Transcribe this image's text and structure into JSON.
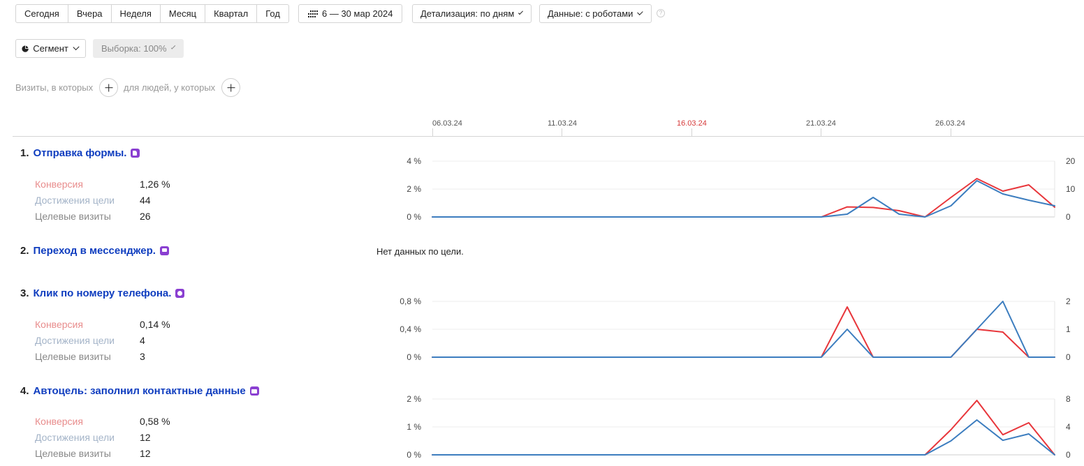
{
  "toolbar": {
    "periods": [
      "Сегодня",
      "Вчера",
      "Неделя",
      "Месяц",
      "Квартал",
      "Год"
    ],
    "date_range": "6 — 30 мар 2024",
    "detail": "Детализация: по дням",
    "data_filter": "Данные: с роботами",
    "help": "?"
  },
  "segment": {
    "segment_label": "Сегмент",
    "sample_label": "Выборка: 100%"
  },
  "filter": {
    "visits_text": "Визиты, в которых",
    "people_text": "для людей, у которых"
  },
  "timeline": {
    "dates": [
      "06.03.24",
      "11.03.24",
      "16.03.24",
      "21.03.24",
      "26.03.24"
    ],
    "holiday_date": "16.03.24"
  },
  "colors": {
    "conversion": "#e8363b",
    "reaches": "#3c7dbf",
    "goal_link": "#0f3dbf",
    "goal_icon": "#8a3fd1"
  },
  "goals": [
    {
      "num": "1.",
      "name": "Отправка формы.",
      "icon": "form-icon",
      "metrics": [
        {
          "label": "Конверсия",
          "value": "1,26 %"
        },
        {
          "label": "Достижения цели",
          "value": "44"
        },
        {
          "label": "Целевые визиты",
          "value": "26"
        }
      ]
    },
    {
      "num": "2.",
      "name": "Переход в мессенджер.",
      "icon": "chat-icon",
      "nodata": "Нет данных по цели."
    },
    {
      "num": "3.",
      "name": "Клик по номеру телефона.",
      "icon": "phone-icon",
      "metrics": [
        {
          "label": "Конверсия",
          "value": "0,14 %"
        },
        {
          "label": "Достижения цели",
          "value": "4"
        },
        {
          "label": "Целевые визиты",
          "value": "3"
        }
      ]
    },
    {
      "num": "4.",
      "name": "Автоцель: заполнил контактные данные",
      "icon": "card-icon",
      "metrics": [
        {
          "label": "Конверсия",
          "value": "0,58 %"
        },
        {
          "label": "Достижения цели",
          "value": "12"
        },
        {
          "label": "Целевые визиты",
          "value": "12"
        }
      ]
    }
  ],
  "chart_data": [
    {
      "type": "line",
      "x": [
        "06.03.24",
        "07.03.24",
        "08.03.24",
        "09.03.24",
        "10.03.24",
        "11.03.24",
        "12.03.24",
        "13.03.24",
        "14.03.24",
        "15.03.24",
        "16.03.24",
        "17.03.24",
        "18.03.24",
        "19.03.24",
        "20.03.24",
        "21.03.24",
        "22.03.24",
        "23.03.24",
        "24.03.24",
        "25.03.24",
        "26.03.24",
        "27.03.24",
        "28.03.24",
        "29.03.24",
        "30.03.24"
      ],
      "left_ticks": [
        "4 %",
        "2 %",
        "0 %"
      ],
      "right_ticks": [
        "20",
        "10",
        "0"
      ],
      "ylim_left": [
        0,
        4
      ],
      "ylim_right": [
        0,
        20
      ],
      "series": [
        {
          "color": "#e8363b",
          "axis": "left",
          "values": [
            0,
            0,
            0,
            0,
            0,
            0,
            0,
            0,
            0,
            0,
            0,
            0,
            0,
            0,
            0,
            0,
            0.72,
            0.68,
            0.45,
            0,
            1.4,
            2.75,
            1.85,
            2.3,
            0.7
          ]
        },
        {
          "color": "#3c7dbf",
          "axis": "left",
          "values": [
            0,
            0,
            0,
            0,
            0,
            0,
            0,
            0,
            0,
            0,
            0,
            0,
            0,
            0,
            0,
            0,
            0.2,
            1.4,
            0.2,
            0,
            0.8,
            2.6,
            1.65,
            1.2,
            0.8
          ]
        }
      ]
    },
    {
      "type": "line",
      "x": [
        "06.03.24",
        "07.03.24",
        "08.03.24",
        "09.03.24",
        "10.03.24",
        "11.03.24",
        "12.03.24",
        "13.03.24",
        "14.03.24",
        "15.03.24",
        "16.03.24",
        "17.03.24",
        "18.03.24",
        "19.03.24",
        "20.03.24",
        "21.03.24",
        "22.03.24",
        "23.03.24",
        "24.03.24",
        "25.03.24",
        "26.03.24",
        "27.03.24",
        "28.03.24",
        "29.03.24",
        "30.03.24"
      ],
      "left_ticks": [
        "0,8 %",
        "0,4 %",
        "0 %"
      ],
      "right_ticks": [
        "2",
        "1",
        "0"
      ],
      "ylim_left": [
        0,
        0.8
      ],
      "ylim_right": [
        0,
        2
      ],
      "series": [
        {
          "color": "#e8363b",
          "axis": "left",
          "values": [
            0,
            0,
            0,
            0,
            0,
            0,
            0,
            0,
            0,
            0,
            0,
            0,
            0,
            0,
            0,
            0,
            0.72,
            0,
            0,
            0,
            0,
            0.4,
            0.36,
            0,
            0
          ]
        },
        {
          "color": "#3c7dbf",
          "axis": "right",
          "values": [
            0,
            0,
            0,
            0,
            0,
            0,
            0,
            0,
            0,
            0,
            0,
            0,
            0,
            0,
            0,
            0,
            1,
            0,
            0,
            0,
            0,
            1,
            2,
            0,
            0
          ]
        }
      ]
    },
    {
      "type": "line",
      "x": [
        "06.03.24",
        "07.03.24",
        "08.03.24",
        "09.03.24",
        "10.03.24",
        "11.03.24",
        "12.03.24",
        "13.03.24",
        "14.03.24",
        "15.03.24",
        "16.03.24",
        "17.03.24",
        "18.03.24",
        "19.03.24",
        "20.03.24",
        "21.03.24",
        "22.03.24",
        "23.03.24",
        "24.03.24",
        "25.03.24",
        "26.03.24",
        "27.03.24",
        "28.03.24",
        "29.03.24",
        "30.03.24"
      ],
      "left_ticks": [
        "2 %",
        "1 %",
        "0 %"
      ],
      "right_ticks": [
        "8",
        "4",
        "0"
      ],
      "ylim_left": [
        0,
        2
      ],
      "ylim_right": [
        0,
        8
      ],
      "series": [
        {
          "color": "#e8363b",
          "axis": "left",
          "values": [
            0,
            0,
            0,
            0,
            0,
            0,
            0,
            0,
            0,
            0,
            0,
            0,
            0,
            0,
            0,
            0,
            0,
            0,
            0,
            0,
            0.9,
            1.95,
            0.72,
            1.15,
            0
          ]
        },
        {
          "color": "#3c7dbf",
          "axis": "left",
          "values": [
            0,
            0,
            0,
            0,
            0,
            0,
            0,
            0,
            0,
            0,
            0,
            0,
            0,
            0,
            0,
            0,
            0,
            0,
            0,
            0,
            0.5,
            1.25,
            0.52,
            0.75,
            0
          ]
        }
      ]
    }
  ]
}
